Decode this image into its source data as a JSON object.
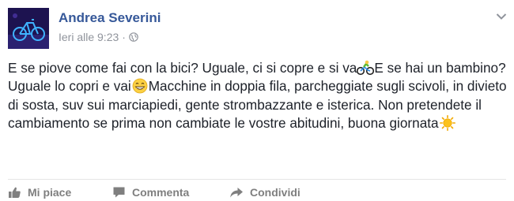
{
  "post": {
    "author": "Andrea Severini",
    "timestamp": "Ieri alle 9:23",
    "separator": "·",
    "privacy_icon": "globe-icon",
    "menu_icon": "chevron-down-icon",
    "message_parts": {
      "p1": "E se piove come fai con la bici? Uguale, ci si copre e si va",
      "emoji1": "cyclist-emoji",
      "p2": "E se hai un bambino? Uguale lo copri e vai",
      "emoji2": "grinning-face-emoji",
      "p3": "Macchine in doppia fila, parcheggiate sugli scivoli, in divieto di sosta, suv sui marciapiedi, gente strombazzante e isterica. Non pretendete il cambiamento se prima non cambiate le vostre abitudini, buona giornata",
      "emoji3": "sun-emoji"
    }
  },
  "actions": {
    "like_label": "Mi piace",
    "comment_label": "Commenta",
    "share_label": "Condividi"
  },
  "colors": {
    "author": "#365899",
    "meta": "#90949c",
    "text": "#1d2129",
    "action": "#7f7f7f",
    "divider": "#e5e5e5"
  }
}
